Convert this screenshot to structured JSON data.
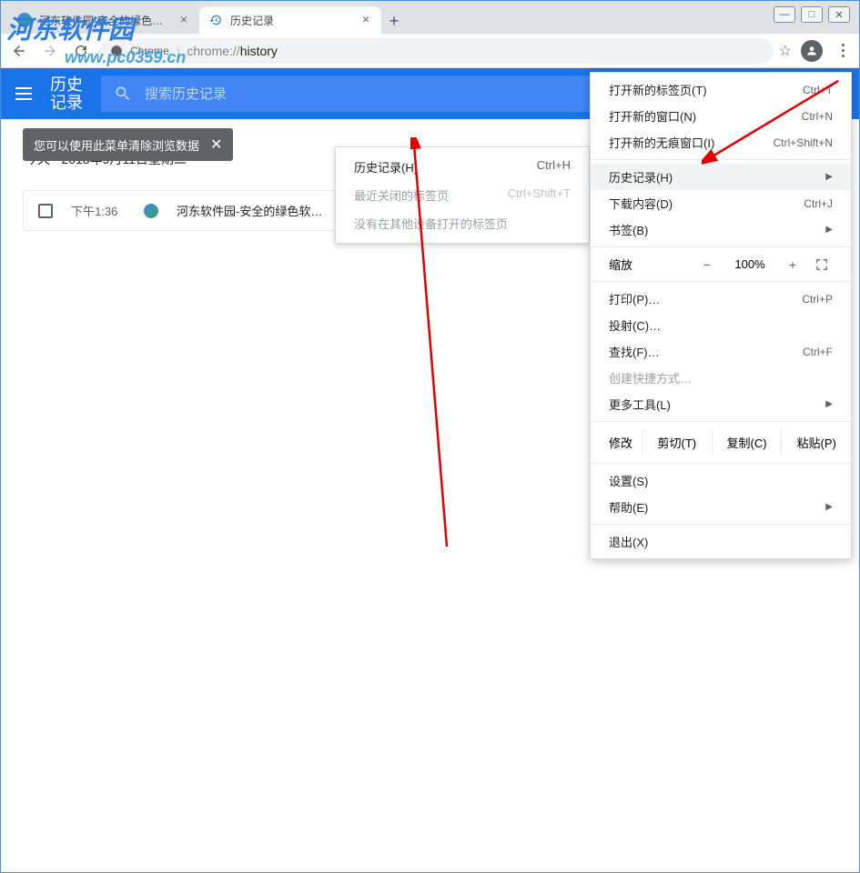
{
  "window": {
    "minimize": "—",
    "maximize": "□",
    "close": "✕"
  },
  "tabs": {
    "tab1": {
      "title": "河东软件园-安全的绿色软件下载"
    },
    "tab2": {
      "title": "历史记录"
    },
    "newtab": "+"
  },
  "addressbar": {
    "chrome_label": "Chrome",
    "url_prefix": "chrome://",
    "url_path": "history",
    "star": "☆"
  },
  "history_header": {
    "title": "历史记录",
    "search_placeholder": "搜索历史记录"
  },
  "tooltip": {
    "text": "您可以使用此菜单清除浏览数据",
    "close": "✕"
  },
  "page": {
    "date_label": "今天 - 2018年9月11日星期二",
    "rows": [
      {
        "time": "下午1:36",
        "title": "河东软件园-安全的绿色软…"
      }
    ]
  },
  "submenu": {
    "items": [
      {
        "label": "历史记录(H)",
        "shortcut": "Ctrl+H",
        "disabled": false
      },
      {
        "label": "最近关闭的标签页",
        "shortcut": "Ctrl+Shift+T",
        "disabled": true
      },
      {
        "label": "没有在其他设备打开的标签页",
        "shortcut": "",
        "disabled": true
      }
    ]
  },
  "mainmenu": {
    "sec1": [
      {
        "label": "打开新的标签页(T)",
        "shortcut": "Ctrl+T"
      },
      {
        "label": "打开新的窗口(N)",
        "shortcut": "Ctrl+N"
      },
      {
        "label": "打开新的无痕窗口(I)",
        "shortcut": "Ctrl+Shift+N"
      }
    ],
    "sec2": [
      {
        "label": "历史记录(H)",
        "shortcut": "",
        "arrow": true,
        "hl": true
      },
      {
        "label": "下载内容(D)",
        "shortcut": "Ctrl+J"
      },
      {
        "label": "书签(B)",
        "shortcut": "",
        "arrow": true
      }
    ],
    "zoom": {
      "label": "缩放",
      "minus": "−",
      "pct": "100%",
      "plus": "+"
    },
    "sec3": [
      {
        "label": "打印(P)…",
        "shortcut": "Ctrl+P"
      },
      {
        "label": "投射(C)…",
        "shortcut": ""
      },
      {
        "label": "查找(F)…",
        "shortcut": "Ctrl+F"
      },
      {
        "label": "创建快捷方式…",
        "shortcut": "",
        "disabled": true
      },
      {
        "label": "更多工具(L)",
        "shortcut": "",
        "arrow": true
      }
    ],
    "edit": {
      "label": "修改",
      "cut": "剪切(T)",
      "copy": "复制(C)",
      "paste": "粘贴(P)"
    },
    "sec4": [
      {
        "label": "设置(S)",
        "shortcut": ""
      },
      {
        "label": "帮助(E)",
        "shortcut": "",
        "arrow": true
      }
    ],
    "sec5": [
      {
        "label": "退出(X)",
        "shortcut": ""
      }
    ]
  },
  "watermark": {
    "text": "河东软件园",
    "url": "www.pc0359.cn"
  }
}
